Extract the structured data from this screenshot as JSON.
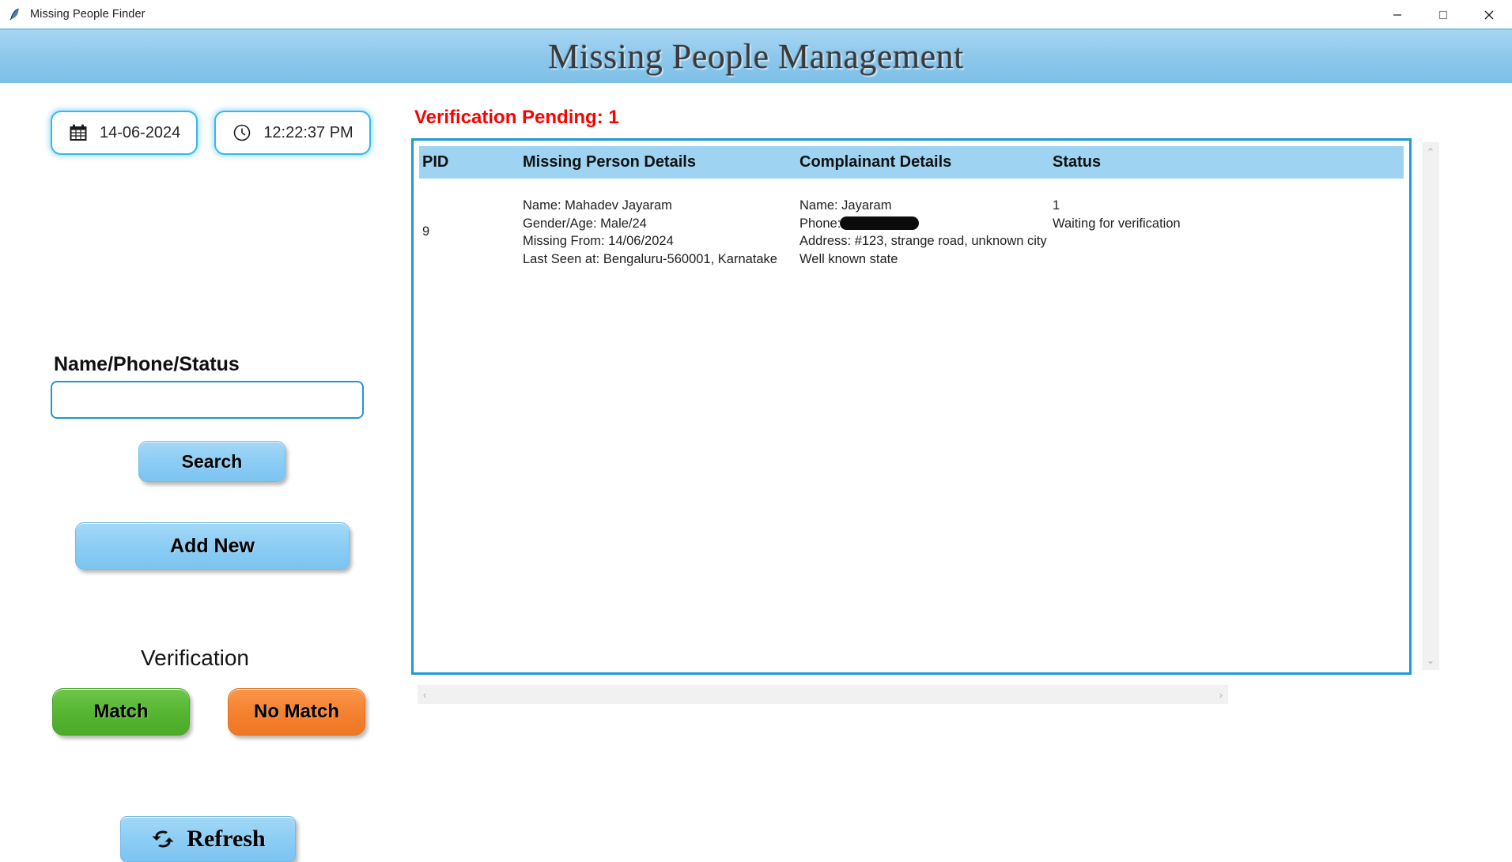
{
  "window": {
    "title": "Missing People Finder",
    "app_icon": "feather-icon",
    "minimize_label": "—",
    "maximize_label": "□",
    "close_label": "✕"
  },
  "header": {
    "title": "Missing People Management",
    "banner_color": "#8ec8ec"
  },
  "sidebar": {
    "date_chip": {
      "icon": "calendar-icon",
      "value": "14-06-2024"
    },
    "time_chip": {
      "icon": "clock-icon",
      "value": "12:22:37 PM"
    },
    "search_field": {
      "label": "Name/Phone/Status",
      "value": "",
      "placeholder": ""
    },
    "search_button": "Search",
    "add_new_button": "Add New",
    "verification_label": "Verification",
    "match_button": "Match",
    "no_match_button": "No Match",
    "refresh_button": "Refresh",
    "refresh_icon": "refresh-icon",
    "colors": {
      "match": "#55b531",
      "no_match": "#f4812e",
      "button_blue": "#8ccdf4",
      "accent": "#1d9ad6"
    }
  },
  "main": {
    "pending_status": "Verification Pending: 1",
    "pending_color": "#ff0000",
    "table": {
      "columns": [
        "PID",
        "Missing Person Details",
        "Complainant Details",
        "Status"
      ],
      "header_bg": "#9ed4f2",
      "rows": [
        {
          "pid": "9",
          "missing_person": [
            "Name: Mahadev Jayaram",
            "Gender/Age: Male/24",
            "Missing From: 14/06/2024",
            "Last Seen at: Bengaluru-560001, Karnatake"
          ],
          "complainant_name": "Name: Jayaram",
          "complainant_phone_label": "Phone:",
          "complainant_phone_value": "",
          "complainant_rest": [
            "Address: #123, strange road, unknown city",
            "Well known state"
          ],
          "status": [
            "1",
            "Waiting for verification"
          ]
        }
      ]
    },
    "scrollbars": {
      "up_arrow": "⌃",
      "down_arrow": "⌄",
      "left_arrow": "‹",
      "right_arrow": "›"
    }
  }
}
